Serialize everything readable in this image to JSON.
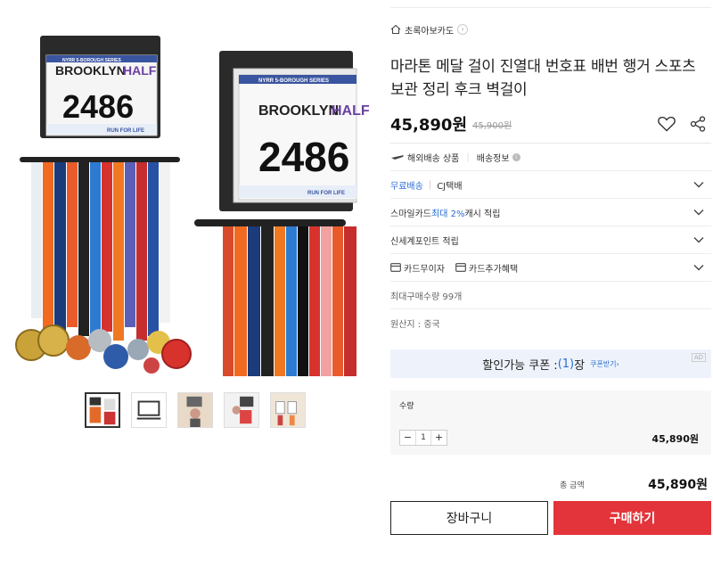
{
  "gallery": {
    "main_image": {
      "bib_series": "NYRR 5-BOROUGH SERIES",
      "bib_title_a": "BROOKLYN",
      "bib_title_b": "HALF",
      "bib_number": "2486",
      "bib_footer": "RUN FOR LIFE"
    },
    "thumbnails": [
      "thumb-1",
      "thumb-2",
      "thumb-3",
      "thumb-4",
      "thumb-5"
    ]
  },
  "breadcrumb": {
    "store": "초록아보카도"
  },
  "product": {
    "title": "마라톤 메달 걸이 진열대 번호표 배번 행거 스포츠 보관 정리 후크 벽걸이",
    "price": "45,890원",
    "original_price": "45,900원"
  },
  "shipping": {
    "overseas": "해외배송 상품",
    "info": "배송정보",
    "free": "무료배송",
    "carrier": "CJ택배"
  },
  "benefits": {
    "smile_card_a": "스마일카드 ",
    "smile_card_b": "최대 2%",
    "smile_card_c": " 캐시 적립",
    "shinsegae": "신세계포인트 적립",
    "card_interest": "카드무이자",
    "card_extra": "카드추가혜택"
  },
  "limits": {
    "max_qty": "최대구매수량 99개",
    "origin": "원산지 : 중국"
  },
  "coupon": {
    "text_a": "할인가능 쿠폰 : ",
    "count": "(1)",
    "text_b": "장",
    "link": "쿠폰받기›",
    "ad": "AD"
  },
  "quantity": {
    "label": "수량",
    "value": "1",
    "minus": "−",
    "plus": "+",
    "line_price": "45,890원"
  },
  "total": {
    "label": "총 금액",
    "price": "45,890원"
  },
  "actions": {
    "cart": "장바구니",
    "buy": "구매하기"
  },
  "colors": {
    "buy": "#e2343a",
    "accent": "#2a6ed4",
    "coupon_bg": "#eef3fb"
  }
}
